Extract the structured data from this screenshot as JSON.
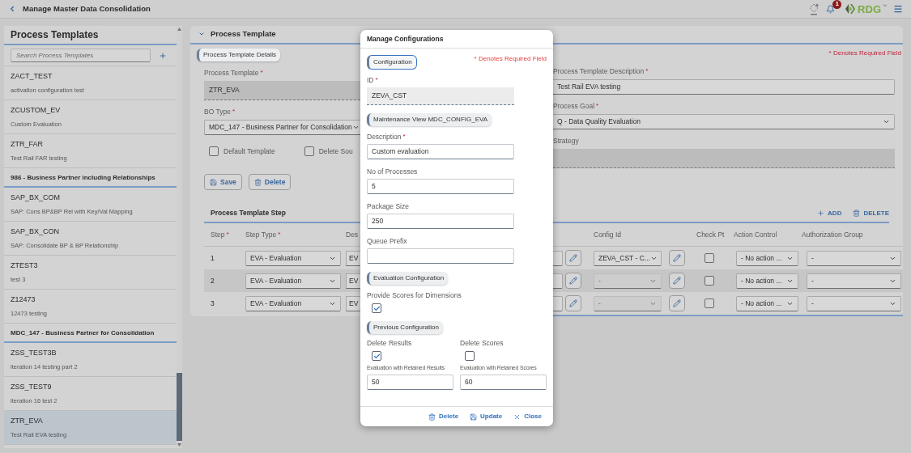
{
  "header": {
    "title": "Manage Master Data Consolidation",
    "notification_count": "1",
    "logo_text": "RDG",
    "logo_mark": "™"
  },
  "sidebar": {
    "title": "Process Templates",
    "search": {
      "placeholder": "Search Process Templates"
    },
    "entries": [
      {
        "kind": "item",
        "name": "ZACT_TEST",
        "description": "activation configuration test",
        "selected": false
      },
      {
        "kind": "item",
        "name": "ZCUSTOM_EV",
        "description": "Custom Evaluation",
        "selected": false
      },
      {
        "kind": "item",
        "name": "ZTR_FAR",
        "description": "Test Rail FAR testing",
        "selected": false
      },
      {
        "kind": "group",
        "label": "986 - Business Partner including Relationships"
      },
      {
        "kind": "item",
        "name": "SAP_BX_COM",
        "description": "SAP: Cons BP&BP Rel with Key/Val Mapping",
        "selected": false
      },
      {
        "kind": "item",
        "name": "SAP_BX_CON",
        "description": "SAP: Consolidate BP & BP Relationship",
        "selected": false
      },
      {
        "kind": "item",
        "name": "ZTEST3",
        "description": "test 3",
        "selected": false
      },
      {
        "kind": "item",
        "name": "Z12473",
        "description": "12473 testing",
        "selected": false
      },
      {
        "kind": "group",
        "label": "MDC_147 - Business Partner for Consolidation"
      },
      {
        "kind": "item",
        "name": "ZSS_TEST3B",
        "description": "iteration 14 testing part 2",
        "selected": false
      },
      {
        "kind": "item",
        "name": "ZSS_TEST9",
        "description": "iteration 16 test 2",
        "selected": false
      },
      {
        "kind": "item",
        "name": "ZTR_EVA",
        "description": "Test Rail EVA testing",
        "selected": true
      }
    ]
  },
  "panel": {
    "title": "Process Template",
    "expanded": true,
    "section_tag": "Process Template Details",
    "required_note": "* Denotes Required Field",
    "left_fields": [
      {
        "kind": "readonly",
        "label": "Process Template",
        "required_mark": "*",
        "value": "ZTR_EVA"
      },
      {
        "kind": "select",
        "label": "BO Type",
        "required_mark": "*",
        "value": "MDC_147 - Business Partner for Consolidation"
      }
    ],
    "right_fields": [
      {
        "kind": "input",
        "label": "Process Template Description",
        "required_mark": "*",
        "value": "Test Rail EVA testing"
      },
      {
        "kind": "select",
        "label": "Process Goal",
        "required_mark": "*",
        "value": "Q - Data Quality Evaluation"
      },
      {
        "kind": "readonly",
        "label": "Strategy"
      }
    ],
    "checkboxes": [
      {
        "label": "Default Template",
        "checked": false
      },
      {
        "label": "Delete Sou",
        "checked": false
      }
    ],
    "actions": [
      {
        "kind": "save",
        "label": "Save"
      },
      {
        "kind": "delete",
        "label": "Delete"
      }
    ],
    "steps": {
      "title": "Process Template Step",
      "actions": [
        {
          "kind": "add",
          "label": "ADD"
        },
        {
          "kind": "delete",
          "label": "DELETE"
        }
      ],
      "columns_left": [
        {
          "label": "Step",
          "required_mark": "*"
        },
        {
          "label": "Step Type",
          "required_mark": "*"
        },
        {
          "label": "Des"
        }
      ],
      "columns_right": [
        {
          "label": "Config Id"
        },
        {
          "label": "Check Pt"
        },
        {
          "label": "Action Control"
        },
        {
          "label": "Authorization Group"
        }
      ],
      "rows": [
        {
          "step": "1",
          "step_type": "EVA - Evaluation",
          "description": "EV",
          "config_id": "ZEVA_CST - C...",
          "config_disabled": false,
          "check_pt": false,
          "action_control": "- No action ...",
          "authorization_group": "-"
        },
        {
          "step": "2",
          "step_type": "EVA - Evaluation",
          "description": "EV",
          "config_id": "-",
          "config_disabled": true,
          "check_pt": false,
          "action_control": "- No action ...",
          "authorization_group": "-"
        },
        {
          "step": "3",
          "step_type": "EVA - Evaluation",
          "description": "EV",
          "config_id": "-",
          "config_disabled": true,
          "check_pt": false,
          "action_control": "- No action ...",
          "authorization_group": "-"
        }
      ]
    }
  },
  "dialog": {
    "title": "Manage Configurations",
    "required_note": "* Denotes Required Field",
    "sections": [
      {
        "tag": "Configuration",
        "focused": true,
        "kind": "stack",
        "fields": [
          {
            "kind": "readonly",
            "label": "ID",
            "required_mark": "*",
            "value": "ZEVA_CST"
          }
        ]
      },
      {
        "tag": "Maintenance View MDC_CONFIG_EVA",
        "focused": false,
        "kind": "stack",
        "fields": [
          {
            "kind": "input",
            "label": "Description",
            "required_mark": "*",
            "value": "Custom evaluation"
          },
          {
            "kind": "input",
            "label": "No of Processes",
            "value": "5"
          },
          {
            "kind": "input",
            "label": "Package Size",
            "value": "250"
          },
          {
            "kind": "input",
            "label": "Queue Prefix"
          }
        ]
      },
      {
        "tag": "Evaluation Configuration",
        "focused": false,
        "kind": "stack",
        "fields": [
          {
            "kind": "checkbox",
            "label": "Provide Scores for Dimensions",
            "checked": true
          }
        ]
      },
      {
        "tag": "Previous Configuration",
        "focused": false,
        "kind": "grid",
        "fields": [
          {
            "kind": "checkbox",
            "label": "Delete Results",
            "checked": true
          },
          {
            "kind": "checkbox",
            "label": "Delete Scores",
            "checked": false
          },
          {
            "kind": "input",
            "label": "Evaluation with Retained Results",
            "value": "50"
          },
          {
            "kind": "input",
            "label": "Evaluation with Retained Scores",
            "value": "60"
          }
        ]
      }
    ],
    "actions": [
      {
        "kind": "delete",
        "label": "Delete"
      },
      {
        "kind": "update",
        "label": "Update"
      },
      {
        "kind": "close",
        "label": "Close"
      }
    ]
  }
}
